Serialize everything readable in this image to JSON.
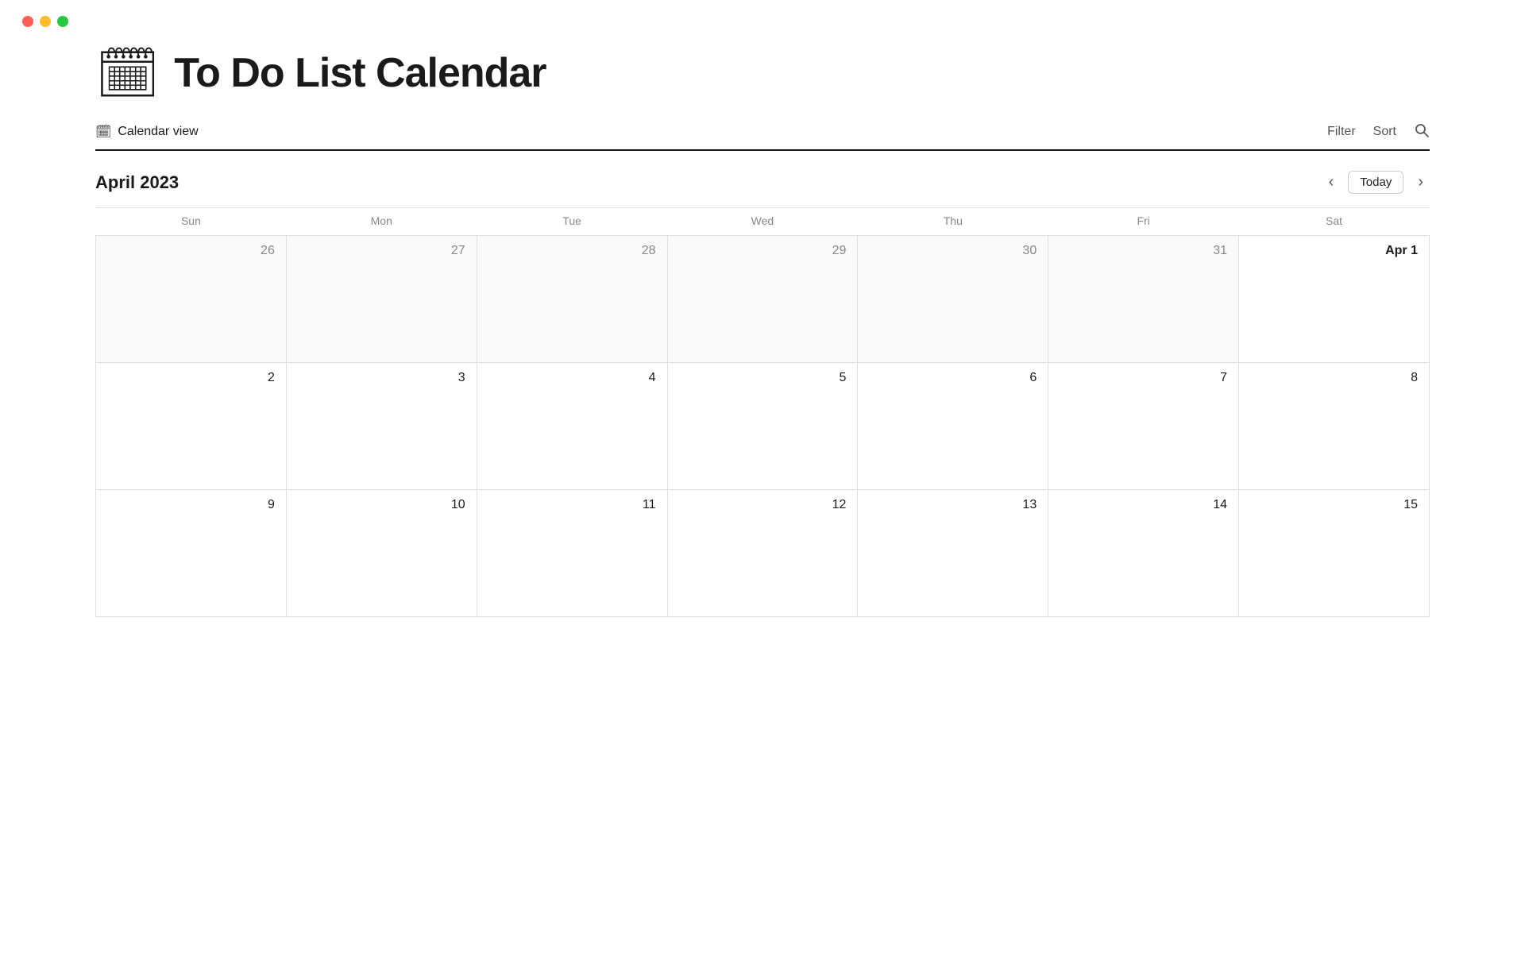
{
  "app": {
    "title": "To Do List Calendar",
    "icon": "📅"
  },
  "traffic_lights": {
    "red": "red",
    "yellow": "yellow",
    "green": "green"
  },
  "toolbar": {
    "view_label": "Calendar view",
    "view_icon": "🗓",
    "filter_label": "Filter",
    "sort_label": "Sort"
  },
  "calendar": {
    "month_label": "April 2023",
    "today_label": "Today",
    "prev_label": "‹",
    "next_label": "›",
    "day_headers": [
      "Sun",
      "Mon",
      "Tue",
      "Wed",
      "Thu",
      "Fri",
      "Sat"
    ],
    "weeks": [
      [
        {
          "date": "26",
          "current": false
        },
        {
          "date": "27",
          "current": false
        },
        {
          "date": "28",
          "current": false
        },
        {
          "date": "29",
          "current": false
        },
        {
          "date": "30",
          "current": false
        },
        {
          "date": "31",
          "current": false
        },
        {
          "date": "Apr 1",
          "current": true,
          "first": true
        }
      ],
      [
        {
          "date": "2",
          "current": true
        },
        {
          "date": "3",
          "current": true
        },
        {
          "date": "4",
          "current": true
        },
        {
          "date": "5",
          "current": true
        },
        {
          "date": "6",
          "current": true
        },
        {
          "date": "7",
          "current": true
        },
        {
          "date": "8",
          "current": true
        }
      ],
      [
        {
          "date": "9",
          "current": true
        },
        {
          "date": "10",
          "current": true
        },
        {
          "date": "11",
          "current": true
        },
        {
          "date": "12",
          "current": true
        },
        {
          "date": "13",
          "current": true
        },
        {
          "date": "14",
          "current": true
        },
        {
          "date": "15",
          "current": true
        }
      ]
    ]
  }
}
